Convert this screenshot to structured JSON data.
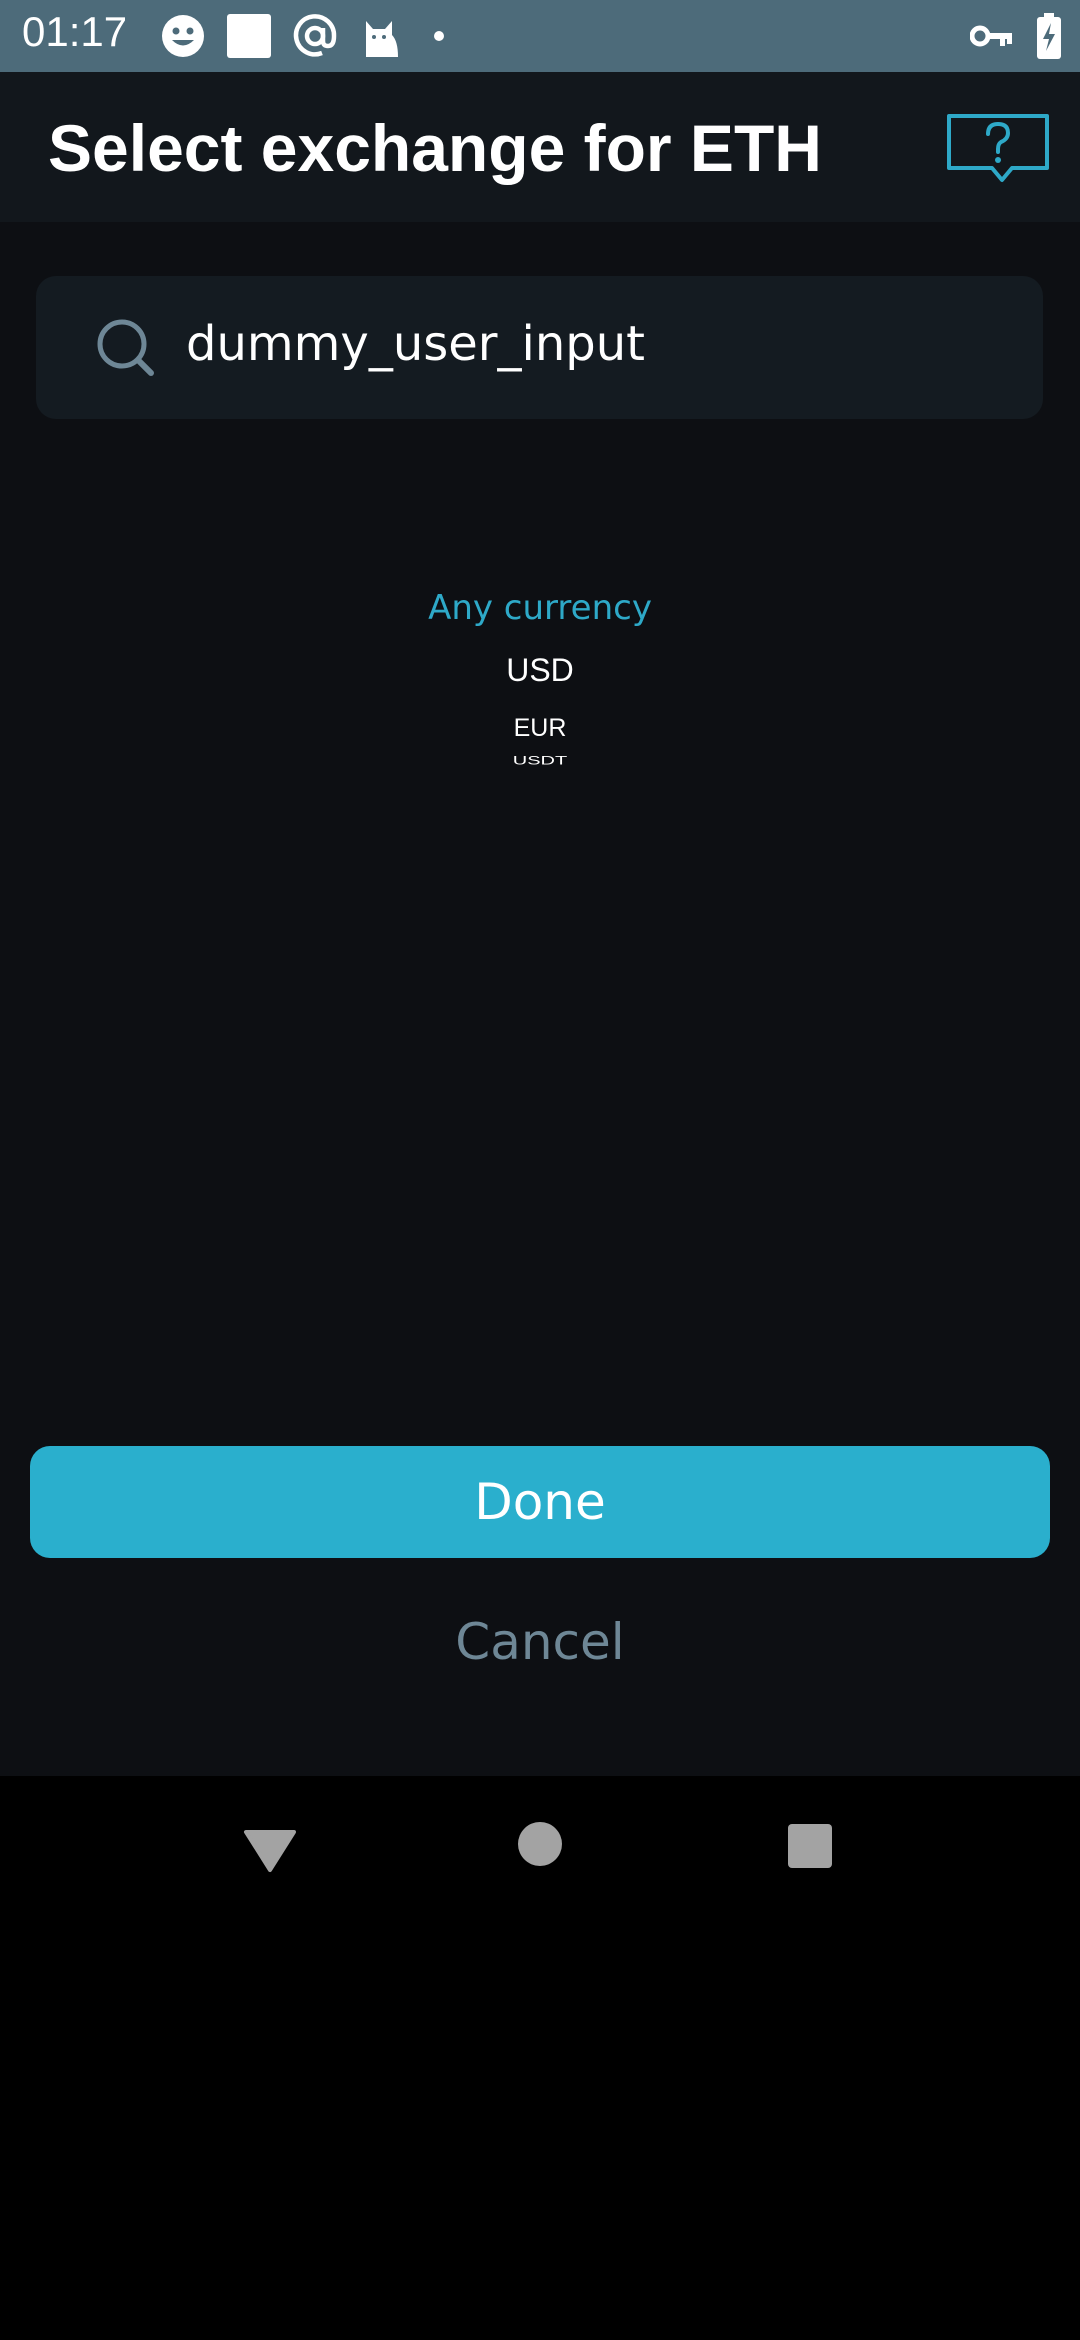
{
  "status_bar": {
    "time": "01:17",
    "left_icons": [
      "smiley-icon",
      "square-notification-icon",
      "at-sign-icon",
      "cat-icon",
      "dot-icon"
    ],
    "right_icons": [
      "vpn-key-icon",
      "battery-charging-icon"
    ]
  },
  "header": {
    "title": "Select exchange for ETH",
    "help_icon": "help-question-icon",
    "accent_color": "#2ea9c8"
  },
  "search": {
    "value": "dummy_user_input",
    "icon": "search-icon"
  },
  "currency_picker": {
    "items": [
      "Any currency",
      "USD",
      "EUR",
      "USDT"
    ],
    "selected": "Any currency"
  },
  "actions": {
    "done_label": "Done",
    "cancel_label": "Cancel",
    "done_color": "#2aafcd"
  },
  "nav_bar": {
    "icons": [
      "back-icon",
      "home-icon",
      "recents-icon"
    ]
  }
}
